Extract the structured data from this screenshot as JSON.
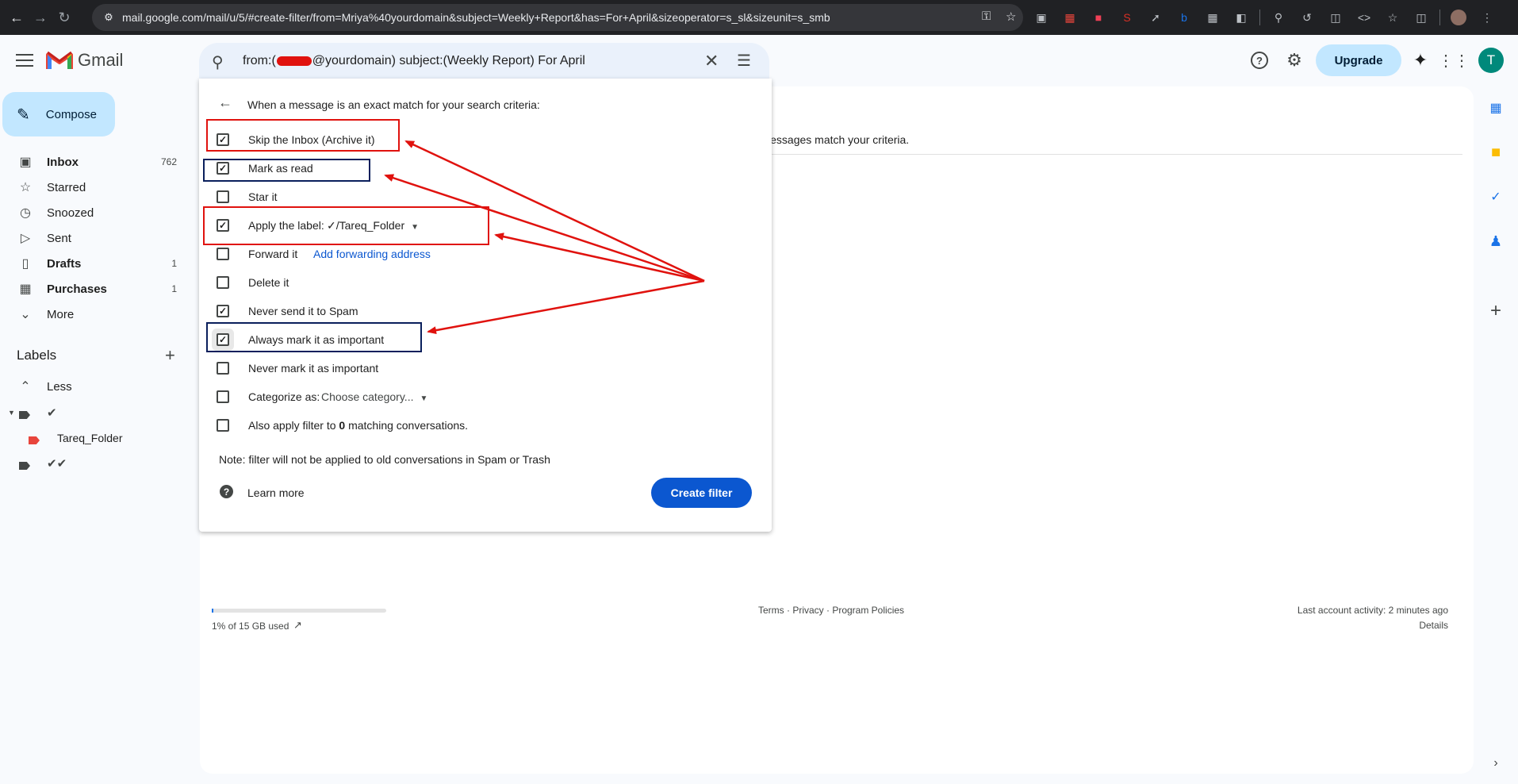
{
  "browser": {
    "url": "mail.google.com/mail/u/5/#create-filter/from=Mriya%40yourdomain&subject=Weekly+Report&has=For+April&sizeoperator=s_sl&sizeunit=s_smb"
  },
  "header": {
    "app_name": "Gmail",
    "search_query_prefix": "from:(",
    "search_query_suffix": "@yourdomain) subject:(Weekly Report) For April",
    "upgrade_label": "Upgrade",
    "avatar_initial": "T"
  },
  "sidebar": {
    "compose_label": "Compose",
    "items": [
      {
        "label": "Inbox",
        "count": "762",
        "icon": "inbox-icon"
      },
      {
        "label": "Starred",
        "count": "",
        "icon": "star-icon"
      },
      {
        "label": "Snoozed",
        "count": "",
        "icon": "clock-icon"
      },
      {
        "label": "Sent",
        "count": "",
        "icon": "send-icon"
      },
      {
        "label": "Drafts",
        "count": "1",
        "icon": "draft-icon"
      },
      {
        "label": "Purchases",
        "count": "1",
        "icon": "shopping-bag-icon"
      },
      {
        "label": "More",
        "count": "",
        "icon": "chevron-down-icon"
      }
    ],
    "labels_heading": "Labels",
    "less_label": "Less",
    "label_items": [
      "✔",
      "Tareq_Folder",
      "✔✔"
    ]
  },
  "filter": {
    "intro": "When a message is an exact match for your search criteria:",
    "options": [
      {
        "label": "Skip the Inbox (Archive it)",
        "checked": true
      },
      {
        "label": "Mark as read",
        "checked": true
      },
      {
        "label": "Star it",
        "checked": false
      },
      {
        "label": "Apply the label:",
        "checked": true
      },
      {
        "label": "Forward it",
        "checked": false
      },
      {
        "label": "Delete it",
        "checked": false
      },
      {
        "label": "Never send it to Spam",
        "checked": true
      },
      {
        "label": "Always mark it as important",
        "checked": true
      },
      {
        "label": "Never mark it as important",
        "checked": false
      },
      {
        "label": "Categorize as:",
        "checked": false
      },
      {
        "label": "Also apply filter to",
        "checked": false
      }
    ],
    "label_value": "✓/Tareq_Folder",
    "forward_link": "Add forwarding address",
    "category_placeholder": "Choose category...",
    "matching_count": "0",
    "matching_suffix": "matching conversations.",
    "note": "Note: filter will not be applied to old conversations in Spam or Trash",
    "learn_more": "Learn more",
    "create_button": "Create filter"
  },
  "main": {
    "background_text": "ng messages match your criteria.",
    "storage_text": "1% of 15 GB used",
    "storage_fraction": 0.01,
    "footer_links": "Terms · Privacy · Program Policies",
    "last_activity": "Last account activity: 2 minutes ago",
    "details_label": "Details"
  },
  "colors": {
    "annotation_red": "#e0120e",
    "annotation_navy": "#0a1f5c",
    "primary_blue": "#0b57d0",
    "compose_bg": "#c2e7ff"
  }
}
